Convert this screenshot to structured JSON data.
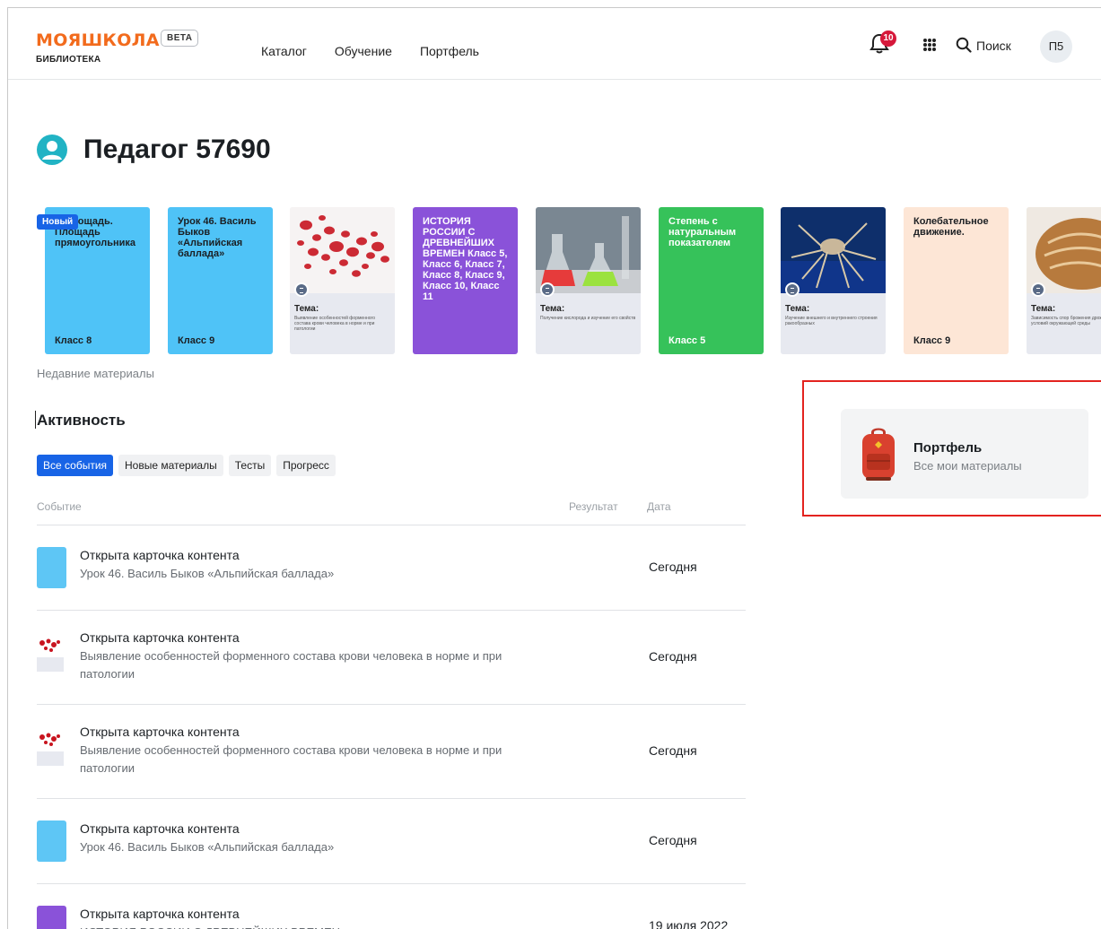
{
  "header": {
    "logo": "МОЯШКОЛА",
    "beta": "BETA",
    "subtitle": "БИБЛИОТЕКА",
    "nav": [
      "Каталог",
      "Обучение",
      "Портфель"
    ],
    "notifications_count": "10",
    "search_label": "Поиск",
    "avatar_initials": "П5"
  },
  "page": {
    "title": "Педагог 57690",
    "recent_label": "Недавние материалы",
    "new_badge": "Новый"
  },
  "cards": [
    {
      "type": "text",
      "bg": "#4fc3f7",
      "title": "…Площадь. Площадь прямоугольника",
      "grade": "Класс 8",
      "color": "#1b1f23"
    },
    {
      "type": "text",
      "bg": "#4fc3f7",
      "title": "Урок 46. Василь Быков «Альпийская баллада»",
      "grade": "Класс 9",
      "color": "#1b1f23"
    },
    {
      "type": "image",
      "img": "blood",
      "topic": "Тема:",
      "desc": "Выявление особенностей форменного состава крови человека в норме и при патологии"
    },
    {
      "type": "text",
      "bg": "#8a52d9",
      "title": "ИСТОРИЯ РОССИИ С ДРЕВНЕЙШИХ ВРЕМЕН Класс 5, Класс 6, Класс 7, Класс 8, Класс 9, Класс 10, Класс 11",
      "grade": "",
      "color": "#ffffff"
    },
    {
      "type": "image",
      "img": "lab",
      "topic": "Тема:",
      "desc": "Получение кислорода и изучение его свойств"
    },
    {
      "type": "text",
      "bg": "#36c25a",
      "title": "Степень с натуральным показателем",
      "grade": "Класс 5",
      "color": "#ffffff"
    },
    {
      "type": "image",
      "img": "crab",
      "topic": "Тема:",
      "desc": "Изучение внешнего и внутреннего строения ракообразных"
    },
    {
      "type": "text",
      "bg": "#fde6d6",
      "title": "Колебательное движение.",
      "grade": "Класс 9",
      "color": "#1b1f23"
    },
    {
      "type": "image",
      "img": "bread",
      "topic": "Тема:",
      "desc": "Зависимость спор брожения дрожжей от условий окружающей среды"
    }
  ],
  "activity": {
    "title": "Активность",
    "filters": [
      "Все события",
      "Новые материалы",
      "Тесты",
      "Прогресс"
    ],
    "active_filter": 0,
    "columns": {
      "event": "Событие",
      "result": "Результат",
      "date": "Дата"
    },
    "rows": [
      {
        "title": "Открыта карточка контента",
        "sub": "Урок 46. Василь Быков «Альпийская баллада»",
        "date": "Сегодня",
        "thumb": "blue"
      },
      {
        "title": "Открыта карточка контента",
        "sub": "Выявление особенностей форменного состава крови человека в норме и при патологии",
        "date": "Сегодня",
        "thumb": "blood"
      },
      {
        "title": "Открыта карточка контента",
        "sub": "Выявление особенностей форменного состава крови человека в норме и при патологии",
        "date": "Сегодня",
        "thumb": "blood"
      },
      {
        "title": "Открыта карточка контента",
        "sub": "Урок 46. Василь Быков «Альпийская баллада»",
        "date": "Сегодня",
        "thumb": "blue"
      },
      {
        "title": "Открыта карточка контента",
        "sub": "ИСТОРИЯ РОССИИ С ДРЕВНЕЙШИХ ВРЕМЕН",
        "date": "19 июля 2022",
        "thumb": "purple"
      }
    ]
  },
  "portfolio": {
    "title": "Портфель",
    "subtitle": "Все мои материалы"
  },
  "colors": {
    "brand": "#f26b1d",
    "accent": "#1864e6",
    "badge": "#d6183a",
    "highlight": "#e3231f"
  }
}
